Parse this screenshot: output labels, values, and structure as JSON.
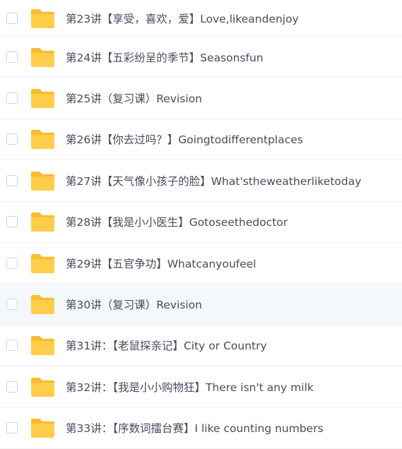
{
  "colors": {
    "folder_body": "#ffcd4a",
    "folder_tab": "#f6bd30",
    "selected_row_background": "#f4f8fd",
    "text": "#454d5c"
  },
  "icons": {
    "folder": "folder-icon",
    "checkbox": "checkbox-unchecked"
  },
  "files": [
    {
      "name": "第23讲【享受，喜欢，爱】Love,likeandenjoy",
      "selected": false
    },
    {
      "name": "第24讲【五彩纷呈的季节】Seasonsfun",
      "selected": false
    },
    {
      "name": "第25讲（复习课）Revision",
      "selected": false
    },
    {
      "name": "第26讲【你去过吗？】Goingtodifferentplaces",
      "selected": false
    },
    {
      "name": "第27讲【天气像小孩子的脸】What'stheweatherliketoday",
      "selected": false
    },
    {
      "name": "第28讲【我是小小医生】Gotoseethedoctor",
      "selected": false
    },
    {
      "name": "第29讲【五官争功】Whatcanyoufeel",
      "selected": false
    },
    {
      "name": "第30讲（复习课）Revision",
      "selected": true
    },
    {
      "name": "第31讲：【老鼠探亲记】City or Country",
      "selected": false
    },
    {
      "name": "第32讲：【我是小小购物狂】There isn't any milk",
      "selected": false
    },
    {
      "name": "第33讲：【序数词擂台赛】I like counting numbers",
      "selected": false
    }
  ]
}
